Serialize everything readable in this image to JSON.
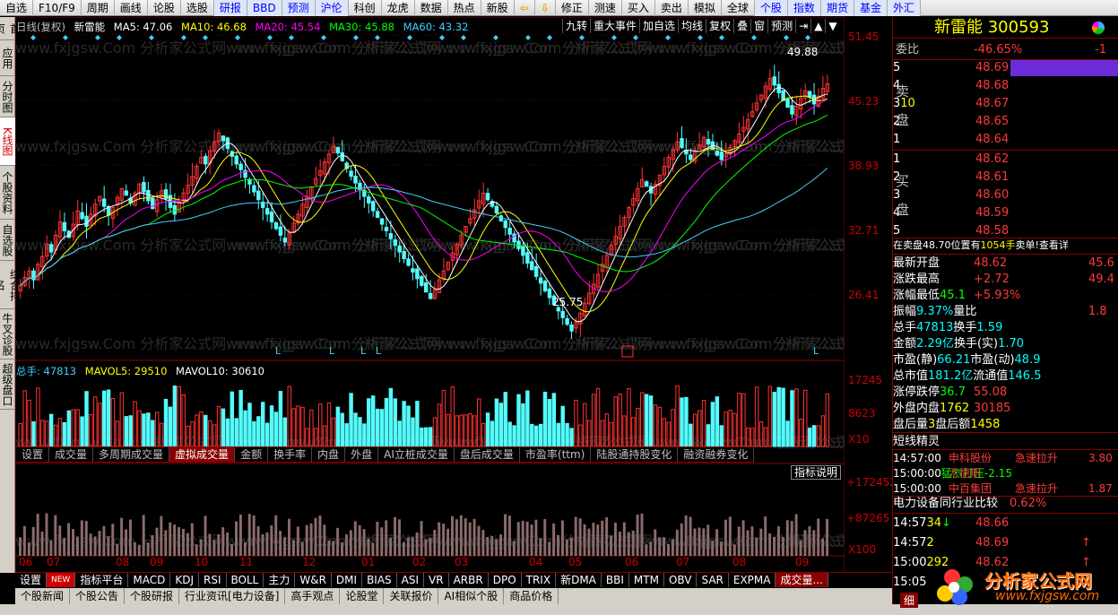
{
  "topbar": [
    "自选",
    "F10/F9",
    "周期",
    "画线",
    "论股",
    "选股",
    "研报",
    "BBD",
    "预测",
    "沪伦",
    "科创",
    "龙虎",
    "数据",
    "热点",
    "新股",
    "",
    "",
    "修正",
    "测速",
    "买入",
    "卖出",
    "模拟",
    "全球",
    "个股",
    "指数",
    "期货",
    "基金",
    "外汇"
  ],
  "leftnav": [
    "首页",
    "应用",
    "分时图",
    "K线图",
    "个股资料",
    "自选股",
    "综合排名",
    "牛叉诊股",
    "超级盘口"
  ],
  "legend": {
    "period": "日线(复权)",
    "name": "新雷能",
    "ma5": "MA5: 47.06",
    "ma10": "MA10: 46.68",
    "ma20": "MA20: 45.54",
    "ma30": "MA30: 45.88",
    "ma60": "MA60: 43.32"
  },
  "toolbtns": [
    "九转",
    "重大事件",
    "加自选",
    "均线",
    "复权",
    "叠",
    "窗",
    "预测",
    "",
    "",
    ""
  ],
  "price_axis": [
    "51.45",
    "45.23",
    "38.93",
    "32.71",
    "26.41"
  ],
  "vol_axis": [
    "17245",
    "8623",
    "X10"
  ],
  "ind_axis": [
    "+172452",
    "+87265",
    "X100"
  ],
  "high_label": "49.88",
  "low_label": "25.75",
  "vol_legend": {
    "total": "总手: 47813",
    "mavol5": "MAVOL5: 29510",
    "mavol10": "MAVOL10: 30610"
  },
  "ind_tabs": [
    "设置",
    "成交量",
    "多周期成交量",
    "虚拟成交量",
    "金额",
    "换手率",
    "内盘",
    "外盘",
    "AI立桩成交量",
    "盘后成交量",
    "市盈率(ttm)",
    "陆股通持股变化",
    "融资融券变化"
  ],
  "ind_note": "指标说明",
  "months": [
    "06",
    "07",
    "08",
    "09",
    "10",
    "11",
    "12",
    "01",
    "02",
    "03",
    "04",
    "05",
    "06",
    "07",
    "08",
    "09"
  ],
  "bot1": [
    "设置",
    "NEW",
    "指标平台",
    "MACD",
    "KDJ",
    "RSI",
    "BOLL",
    "主力",
    "W&R",
    "DMI",
    "BIAS",
    "ASI",
    "VR",
    "ARBR",
    "DPO",
    "TRIX",
    "新DMA",
    "BBI",
    "MTM",
    "OBV",
    "SAR",
    "EXPMA",
    "成交量..."
  ],
  "bot2": [
    "个股新闻",
    "个股公告",
    "个股研报",
    "行业资讯[电力设备]",
    "高手观点",
    "论股堂",
    "关联报价",
    "AI相似个股",
    "商品价格"
  ],
  "right": {
    "name": "新雷能",
    "code": "300593",
    "weibi_label": "委比",
    "weibi": "-46.65%",
    "weibi2": "-1",
    "sell_label": [
      "卖",
      "盘"
    ],
    "buy_label": [
      "买",
      "盘"
    ],
    "sells": [
      {
        "n": "5",
        "p": "48.69"
      },
      {
        "n": "4",
        "p": "48.68"
      },
      {
        "n": "3",
        "p": "48.67",
        "v": "10"
      },
      {
        "n": "2",
        "p": "48.65"
      },
      {
        "n": "1",
        "p": "48.64"
      }
    ],
    "buys": [
      {
        "n": "1",
        "p": "48.62"
      },
      {
        "n": "2",
        "p": "48.61"
      },
      {
        "n": "3",
        "p": "48.60"
      },
      {
        "n": "4",
        "p": "48.59"
      },
      {
        "n": "5",
        "p": "48.58"
      }
    ],
    "sellmsg": "在卖盘48.70位置有",
    "sellvol": "1054手",
    "sellact": "卖单!",
    "sellmore": "查看详",
    "stats": [
      [
        "最新",
        "48.62",
        "开盘",
        "45.6"
      ],
      [
        "涨跌",
        "+2.72",
        "最高",
        "49.4"
      ],
      [
        "涨幅",
        "+5.93%",
        "最低",
        "45.1"
      ],
      [
        "振幅",
        "9.37%",
        "量比",
        "1.8"
      ],
      [
        "总手",
        "47813",
        "换手",
        "1.59"
      ],
      [
        "金额",
        "2.29亿",
        "换手(实)",
        "1.70"
      ],
      [
        "市盈(静)",
        "66.21",
        "市盈(动)",
        "48.9"
      ],
      [
        "总市值",
        "181.2亿",
        "流通值",
        "146.5"
      ],
      [
        "涨停",
        "55.08",
        "跌停",
        "36.7"
      ],
      [
        "外盘",
        "30185",
        "内盘",
        "1762"
      ],
      [
        "盘后量",
        "3",
        "盘后额",
        "1458"
      ]
    ],
    "short_title": "短线精灵",
    "short": [
      [
        "14:57:00",
        "申科股份",
        "急速拉升",
        "3.80"
      ],
      [
        "15:00:00",
        "万德斯",
        "猛烈打压",
        "-2.15"
      ],
      [
        "15:00:00",
        "中百集团",
        "急速拉升",
        "1.87"
      ]
    ],
    "sector": "电力设备",
    "sector_pct": "0.62%",
    "sector_btn": "同行业比较",
    "ticks": [
      [
        "14:57",
        "48.66",
        "34"
      ],
      [
        "14:57",
        "48.69",
        "2"
      ],
      [
        "15:00",
        "48.62",
        "292"
      ],
      [
        "15:05",
        "",
        ""
      ]
    ],
    "tab_detail": "细"
  },
  "watermark": {
    "text": "分析家公式网",
    "url": "www.fxjgsw.com",
    "bg": "www.fxjgsw.Com 分析家公式网"
  },
  "chart_data": {
    "type": "candlestick",
    "high": 49.88,
    "low": 25.75,
    "ylim": [
      24,
      53
    ],
    "closes": [
      30.5,
      31.2,
      31.8,
      31.0,
      32.4,
      33.1,
      34.2,
      33.5,
      35.0,
      36.2,
      35.4,
      34.8,
      36.0,
      37.2,
      36.5,
      35.8,
      36.9,
      37.8,
      38.5,
      37.6,
      36.8,
      37.5,
      38.4,
      39.2,
      38.6,
      37.9,
      38.8,
      39.6,
      38.9,
      38.1,
      37.4,
      38.2,
      39.0,
      38.3,
      37.5,
      36.9,
      38.0,
      38.8,
      39.5,
      40.3,
      41.2,
      42.0,
      41.4,
      42.6,
      43.4,
      44.2,
      43.5,
      42.8,
      42.1,
      41.4,
      40.9,
      40.2,
      39.6,
      38.9,
      38.2,
      37.5,
      36.9,
      36.2,
      35.6,
      35.0,
      34.4,
      35.2,
      36.1,
      36.9,
      37.8,
      38.5,
      39.3,
      40.1,
      40.8,
      41.6,
      42.3,
      43.0,
      42.4,
      41.7,
      41.0,
      40.3,
      39.7,
      39.1,
      38.5,
      37.9,
      37.2,
      36.6,
      36.0,
      35.4,
      34.7,
      34.1,
      33.5,
      32.9,
      32.3,
      31.7,
      31.1,
      30.5,
      29.9,
      29.3,
      30.1,
      31.0,
      31.8,
      32.6,
      33.4,
      34.2,
      35.0,
      35.8,
      36.5,
      37.3,
      38.1,
      38.8,
      38.2,
      37.6,
      37.0,
      36.3,
      35.7,
      35.1,
      34.4,
      33.8,
      33.2,
      32.5,
      31.9,
      31.3,
      30.7,
      30.0,
      29.4,
      28.8,
      28.2,
      27.6,
      27.0,
      26.4,
      27.2,
      28.0,
      28.9,
      29.8,
      30.6,
      31.5,
      32.4,
      33.2,
      34.1,
      34.9,
      35.8,
      36.6,
      37.5,
      38.3,
      39.2,
      40.0,
      39.4,
      38.8,
      39.6,
      40.4,
      41.2,
      42.0,
      42.7,
      43.4,
      42.9,
      42.3,
      41.8,
      42.5,
      43.1,
      43.8,
      43.2,
      42.7,
      42.2,
      41.8,
      42.3,
      42.9,
      43.5,
      44.1,
      44.7,
      45.4,
      46.1,
      46.9,
      47.6,
      48.4,
      49.1,
      48.5,
      47.8,
      47.1,
      46.5,
      45.9,
      46.6,
      47.3,
      48.0,
      47.4,
      46.8,
      47.5,
      48.2,
      48.62
    ],
    "volume_axis": [
      17245,
      8623
    ],
    "ma_labels": [
      "MA5",
      "MA10",
      "MA20",
      "MA30",
      "MA60"
    ]
  }
}
